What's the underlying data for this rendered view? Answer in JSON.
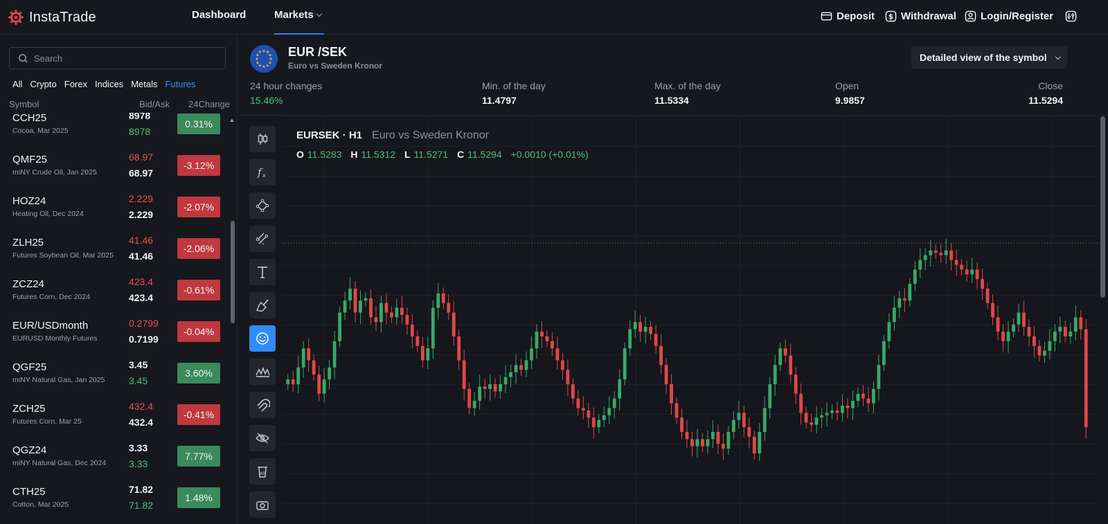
{
  "brand": {
    "name": "InstaTrade"
  },
  "nav": {
    "dashboard": "Dashboard",
    "markets": "Markets",
    "deposit": "Deposit",
    "withdrawal": "Withdrawal",
    "login": "Login/Register"
  },
  "sidebar": {
    "search_placeholder": "Search",
    "filters": [
      "All",
      "Crypto",
      "Forex",
      "Indices",
      "Metals",
      "Futures"
    ],
    "active_filter": "Futures",
    "columns": {
      "symbol": "Symbol",
      "bidask": "Bid/Ask",
      "change": "24Change"
    },
    "rows": [
      {
        "symbol": "CCH25",
        "desc": "Cocoa, Mar 2025",
        "bid": "8978",
        "ask": "8978",
        "change": "0.31%",
        "bid_color": "white",
        "ask_color": "green",
        "dir": "up"
      },
      {
        "symbol": "QMF25",
        "desc": "miNY Crude Oil, Jan 2025",
        "bid": "68.97",
        "ask": "68.97",
        "change": "-3.12%",
        "bid_color": "red",
        "ask_color": "white",
        "dir": "down"
      },
      {
        "symbol": "HOZ24",
        "desc": "Heating Oil, Dec 2024",
        "bid": "2.229",
        "ask": "2.229",
        "change": "-2.07%",
        "bid_color": "red",
        "ask_color": "white",
        "dir": "down"
      },
      {
        "symbol": "ZLH25",
        "desc": "Futures Soybean Oil, Mar 2025",
        "bid": "41.46",
        "ask": "41.46",
        "change": "-2.06%",
        "bid_color": "red",
        "ask_color": "white",
        "dir": "down"
      },
      {
        "symbol": "ZCZ24",
        "desc": "Futures Corn, Dec 2024",
        "bid": "423.4",
        "ask": "423.4",
        "change": "-0.61%",
        "bid_color": "red",
        "ask_color": "white",
        "dir": "down"
      },
      {
        "symbol": "EUR/USDmonth",
        "desc": "EURUSD Monthly Futures",
        "bid": "0.2799",
        "ask": "0.7199",
        "change": "-0.04%",
        "bid_color": "red",
        "ask_color": "white",
        "dir": "down"
      },
      {
        "symbol": "QGF25",
        "desc": "miNY Natural Gas, Jan 2025",
        "bid": "3.45",
        "ask": "3.45",
        "change": "3.60%",
        "bid_color": "white",
        "ask_color": "green",
        "dir": "up"
      },
      {
        "symbol": "ZCH25",
        "desc": "Futures Corn, Mar 25",
        "bid": "432.4",
        "ask": "432.4",
        "change": "-0.41%",
        "bid_color": "red",
        "ask_color": "white",
        "dir": "down"
      },
      {
        "symbol": "QGZ24",
        "desc": "miNY Natural Gas, Dec 2024",
        "bid": "3.33",
        "ask": "3.33",
        "change": "7.77%",
        "bid_color": "white",
        "ask_color": "green",
        "dir": "up"
      },
      {
        "symbol": "CTH25",
        "desc": "Cotton, Mar 2025",
        "bid": "71.82",
        "ask": "71.82",
        "change": "1.48%",
        "bid_color": "white",
        "ask_color": "green",
        "dir": "up"
      }
    ]
  },
  "symbol": {
    "title": "EUR /SEK",
    "subtitle": "Euro vs Sweden Kronor",
    "detail_button": "Detailed view of the symbol",
    "stats": {
      "change_label": "24 hour changes",
      "change_value": "15.46%",
      "min_label": "Min. of the day",
      "min_value": "11.4797",
      "max_label": "Max. of the day",
      "max_value": "11.5334",
      "open_label": "Open",
      "open_value": "9.9857",
      "close_label": "Close",
      "close_value": "11.5294"
    }
  },
  "chart": {
    "ticker": "EURSEK · H1",
    "name": "Euro vs Sweden Kronor",
    "o_label": "O",
    "o": "11.5283",
    "h_label": "H",
    "h": "11.5312",
    "l_label": "L",
    "l": "11.5271",
    "c_label": "C",
    "c": "11.5294",
    "change": "+0.0010 (+0.01%)",
    "up_color": "#3aa86a",
    "down_color": "#e04848",
    "closes": [
      0.42,
      0.4,
      0.47,
      0.55,
      0.5,
      0.44,
      0.36,
      0.42,
      0.47,
      0.58,
      0.7,
      0.75,
      0.8,
      0.7,
      0.75,
      0.76,
      0.68,
      0.66,
      0.74,
      0.7,
      0.68,
      0.72,
      0.69,
      0.65,
      0.6,
      0.56,
      0.5,
      0.55,
      0.72,
      0.78,
      0.74,
      0.7,
      0.6,
      0.5,
      0.38,
      0.3,
      0.33,
      0.39,
      0.38,
      0.4,
      0.37,
      0.4,
      0.43,
      0.45,
      0.48,
      0.46,
      0.5,
      0.55,
      0.62,
      0.6,
      0.58,
      0.55,
      0.5,
      0.46,
      0.4,
      0.34,
      0.3,
      0.29,
      0.26,
      0.22,
      0.25,
      0.27,
      0.3,
      0.34,
      0.42,
      0.55,
      0.63,
      0.66,
      0.62,
      0.64,
      0.61,
      0.56,
      0.48,
      0.4,
      0.32,
      0.26,
      0.2,
      0.17,
      0.14,
      0.17,
      0.14,
      0.17,
      0.2,
      0.15,
      0.13,
      0.2,
      0.25,
      0.28,
      0.22,
      0.18,
      0.11,
      0.2,
      0.3,
      0.4,
      0.48,
      0.55,
      0.52,
      0.44,
      0.36,
      0.28,
      0.24,
      0.23,
      0.26,
      0.27,
      0.28,
      0.29,
      0.28,
      0.31,
      0.3,
      0.33,
      0.36,
      0.34,
      0.32,
      0.38,
      0.48,
      0.58,
      0.66,
      0.72,
      0.76,
      0.75,
      0.82,
      0.88,
      0.92,
      0.94,
      0.96,
      0.95,
      0.94,
      0.96,
      0.92,
      0.9,
      0.88,
      0.86,
      0.88,
      0.84,
      0.8,
      0.74,
      0.68,
      0.62,
      0.58,
      0.62,
      0.65,
      0.7,
      0.64,
      0.6,
      0.56,
      0.52,
      0.54,
      0.58,
      0.62,
      0.64,
      0.6,
      0.62,
      0.68,
      0.63,
      0.22
    ]
  }
}
